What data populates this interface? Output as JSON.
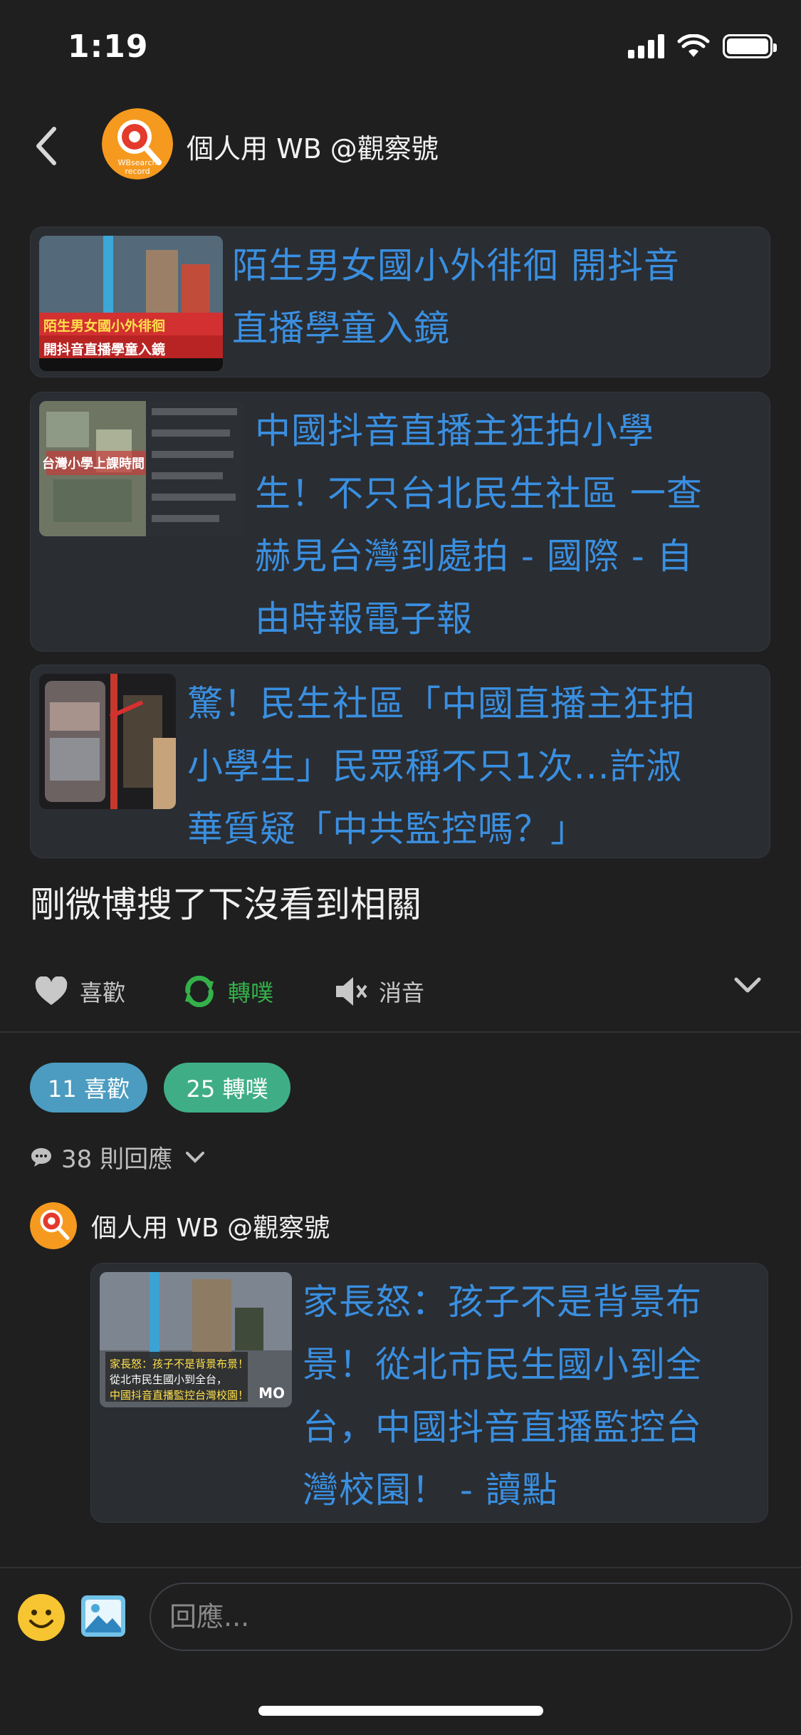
{
  "status_bar": {
    "time": "1:19"
  },
  "header": {
    "title": "個人用 WB @觀察號",
    "avatar_text": "WBsearch record"
  },
  "cards": [
    {
      "title_lines": [
        "陌生男女國小外徘徊 開抖音",
        "直播學童入鏡"
      ],
      "thumb_caption_1": "陌生男女國小外徘徊",
      "thumb_caption_2": "開抖音直播學童入鏡"
    },
    {
      "title_lines": [
        "中國抖音直播主狂拍小學",
        "生！不只台北民生社區 一查",
        "赫見台灣到處拍 - 國際 - 自",
        "由時報電子報"
      ],
      "thumb_caption_1": "台灣小學上課時間"
    },
    {
      "title_lines": [
        "驚！民生社區「中國直播主狂拍",
        "小學生」民眾稱不只1次...許淑",
        "華質疑「中共監控嗎？」"
      ]
    }
  ],
  "post": {
    "text": "剛微博搜了下沒看到相關"
  },
  "actions": {
    "like": "喜歡",
    "repost": "轉噗",
    "mute": "消音"
  },
  "stats": {
    "likes": "11 喜歡",
    "reposts": "25 轉噗"
  },
  "replies": {
    "count_label": "38 則回應"
  },
  "reply": {
    "name": "個人用 WB @觀察號",
    "card": {
      "title_lines": [
        "家長怒：孩子不是背景布",
        "景！從北市民生國小到全",
        "台，中國抖音直播監控台",
        "灣校園！ - 讀點"
      ],
      "thumb_caption_1": "家長怒：孩子不是背景布景！",
      "thumb_caption_2": "從北市民生國小到全台，",
      "thumb_caption_3": "中國抖音直播監控台灣校園！",
      "thumb_logo": "MO"
    }
  },
  "composer": {
    "placeholder": "回應..."
  },
  "colors": {
    "link": "#3a8fe0",
    "repost_green": "#35b14a",
    "likes_pill": "#4b9cc0",
    "reposts_pill": "#3fae86"
  }
}
